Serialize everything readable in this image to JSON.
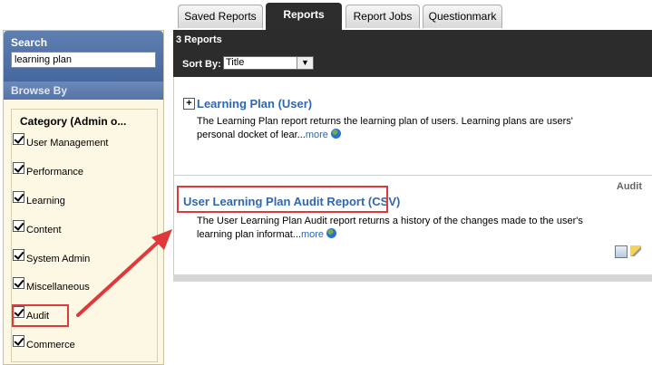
{
  "tabs": [
    "Saved Reports",
    "Reports",
    "Report Jobs",
    "Questionmark"
  ],
  "sidebar": {
    "search_title": "Search",
    "search_value": "learning plan",
    "browse_title": "Browse By",
    "category_title": "Category (Admin o...",
    "categories": [
      "User Management",
      "Performance",
      "Learning",
      "Content",
      "System Admin",
      "Miscellaneous",
      "Audit",
      "Commerce"
    ]
  },
  "main": {
    "count": "3 Reports",
    "sort_label": "Sort By:",
    "sort_value": "Title"
  },
  "results": [
    {
      "title": "Learning Plan (User)",
      "desc": "The Learning Plan report returns the learning plan of users. Learning plans are users' personal docket of lear...",
      "more": "more"
    },
    {
      "category": "Audit",
      "title": "User Learning Plan Audit Report (CSV)",
      "desc": "The User Learning Plan Audit report returns a history of the changes made to the user's learning plan informat...",
      "more": "more"
    }
  ],
  "colors": {
    "highlight": "#e0393b",
    "link": "#2f67b1",
    "header": "#2c2c2c"
  }
}
